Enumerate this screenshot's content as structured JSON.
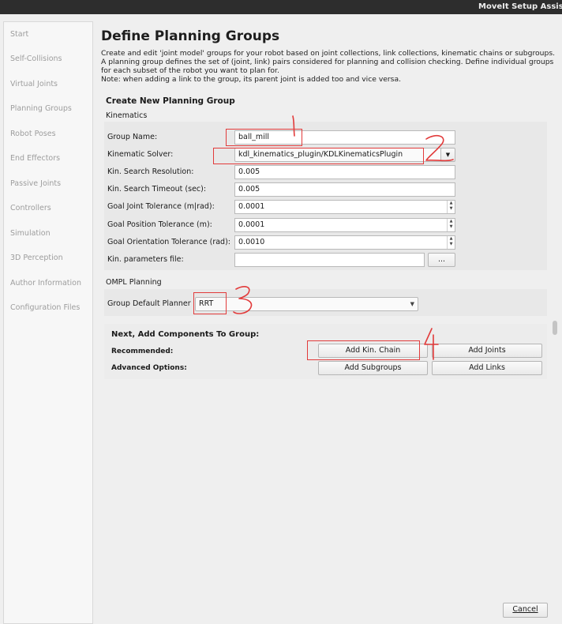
{
  "window": {
    "title": "MoveIt Setup Assista"
  },
  "sidebar": {
    "items": [
      {
        "label": "Start"
      },
      {
        "label": "Self-Collisions"
      },
      {
        "label": "Virtual Joints"
      },
      {
        "label": "Planning Groups"
      },
      {
        "label": "Robot Poses"
      },
      {
        "label": "End Effectors"
      },
      {
        "label": "Passive Joints"
      },
      {
        "label": "Controllers"
      },
      {
        "label": "Simulation"
      },
      {
        "label": "3D Perception"
      },
      {
        "label": "Author Information"
      },
      {
        "label": "Configuration Files"
      }
    ]
  },
  "page": {
    "title": "Define Planning Groups",
    "desc1": "Create and edit 'joint model' groups for your robot based on joint collections, link collections, kinematic chains or subgroups. A planning group defines the set of (joint, link) pairs considered for planning and collision checking. Define individual groups for each subset of the robot you want to plan for.",
    "desc2": "Note: when adding a link to the group, its parent joint is added too and vice versa."
  },
  "form": {
    "section_title": "Create New Planning Group",
    "kinematics_title": "Kinematics",
    "group_name_label": "Group Name:",
    "group_name_value": "ball_mill",
    "solver_label": "Kinematic Solver:",
    "solver_value": "kdl_kinematics_plugin/KDLKinematicsPlugin",
    "search_res_label": "Kin. Search Resolution:",
    "search_res_value": "0.005",
    "search_timeout_label": "Kin. Search Timeout (sec):",
    "search_timeout_value": "0.005",
    "goal_joint_label": "Goal Joint Tolerance (m|rad):",
    "goal_joint_value": "0.0001",
    "goal_pos_label": "Goal Position Tolerance (m):",
    "goal_pos_value": "0.0001",
    "goal_orient_label": "Goal Orientation Tolerance (rad):",
    "goal_orient_value": "0.0010",
    "params_file_label": "Kin. parameters file:",
    "params_file_value": "",
    "browse_label": "...",
    "ompl_title": "OMPL Planning",
    "planner_label": "Group Default Planner",
    "planner_value": "RRT"
  },
  "components": {
    "title": "Next, Add Components To Group:",
    "recommended_label": "Recommended:",
    "advanced_label": "Advanced Options:",
    "add_chain": "Add Kin. Chain",
    "add_joints": "Add Joints",
    "add_subgroups": "Add Subgroups",
    "add_links": "Add Links"
  },
  "footer": {
    "cancel": "Cancel"
  },
  "annotations": {
    "color": "#e23b3b",
    "marks": [
      "1",
      "2",
      "3",
      "4"
    ]
  }
}
